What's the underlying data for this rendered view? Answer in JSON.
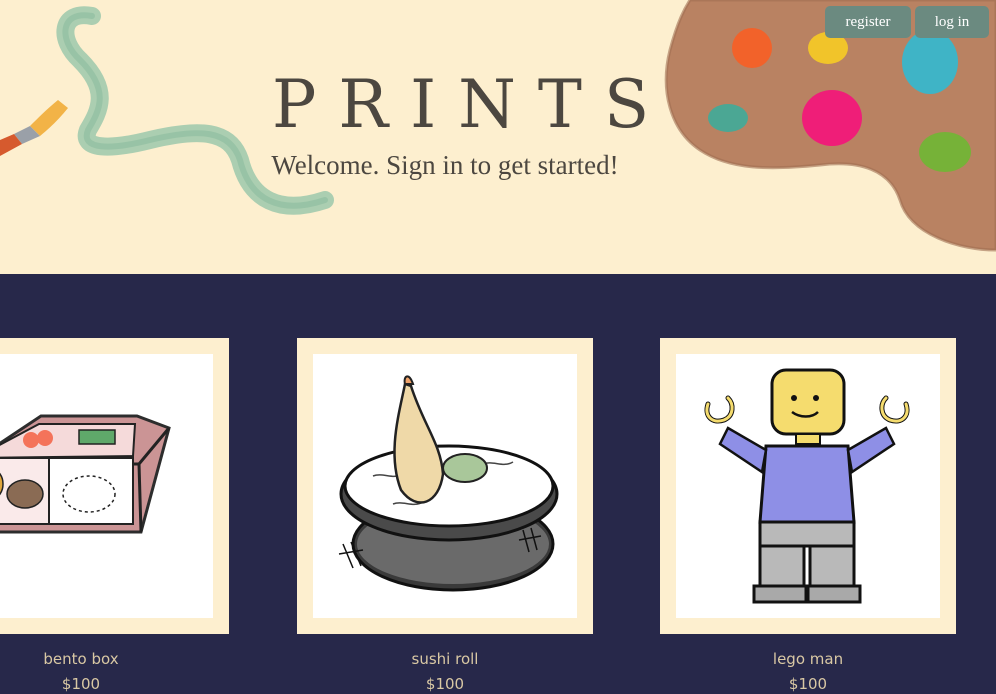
{
  "header": {
    "title": "PRINTS",
    "welcome": "Welcome. Sign in to get started!",
    "register_label": "register",
    "login_label": "log in"
  },
  "products": [
    {
      "name": "bento box",
      "price": "$100",
      "icon": "bento-box-illustration"
    },
    {
      "name": "sushi roll",
      "price": "$100",
      "icon": "sushi-roll-illustration"
    },
    {
      "name": "lego man",
      "price": "$100",
      "icon": "lego-man-illustration"
    }
  ],
  "colors": {
    "header_bg": "#fdefcf",
    "gallery_bg": "#27284a",
    "button_bg": "#6b8a80",
    "title_text": "#4c4740",
    "caption_text": "#d9c8a4"
  }
}
